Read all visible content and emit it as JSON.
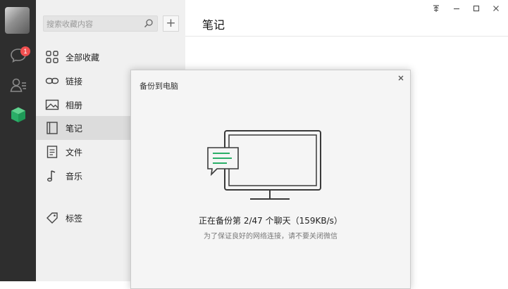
{
  "app": {
    "accent_color": "#2aae67"
  },
  "nav": {
    "unread_badge": "1",
    "icons": [
      "chat-icon",
      "contacts-icon",
      "favorites-cube-icon"
    ]
  },
  "search": {
    "placeholder": "搜索收藏内容"
  },
  "sidebar": {
    "items": [
      {
        "label": "全部收藏",
        "icon": "grid-icon"
      },
      {
        "label": "链接",
        "icon": "link-icon"
      },
      {
        "label": "相册",
        "icon": "image-icon"
      },
      {
        "label": "笔记",
        "icon": "note-icon"
      },
      {
        "label": "文件",
        "icon": "file-icon"
      },
      {
        "label": "音乐",
        "icon": "music-icon"
      },
      {
        "label": "标签",
        "icon": "tag-icon"
      }
    ],
    "active": "笔记"
  },
  "main": {
    "title": "笔记"
  },
  "dialog": {
    "title": "备份到电脑",
    "status": "正在备份第 2/47 个聊天（159KB/s）",
    "hint": "为了保证良好的网络连接，请不要关闭微信"
  }
}
